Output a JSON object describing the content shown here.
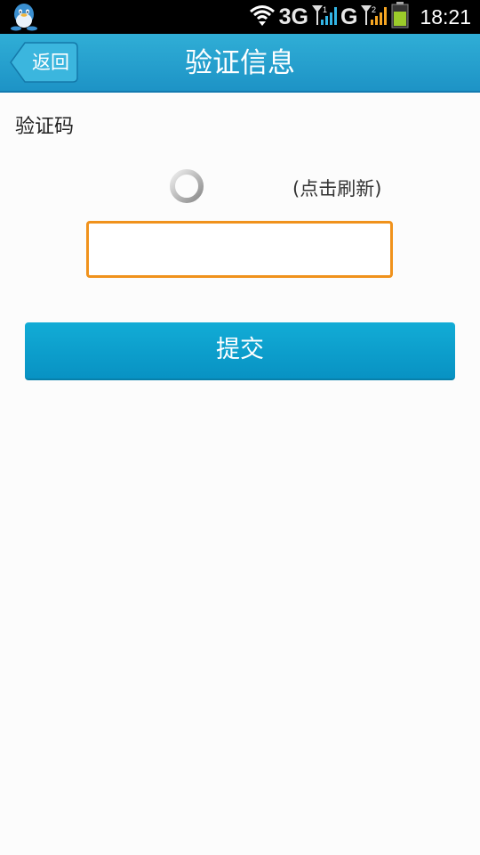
{
  "status_bar": {
    "app_icon": "qq-penguin-icon",
    "wifi_icon": "wifi-icon",
    "network_3g_label": "3G",
    "sim1_signal_icon": "signal-sim1-icon",
    "network_g_label": "G",
    "sim2_signal_icon": "signal-sim2-icon",
    "battery_icon": "battery-icon",
    "battery_color": "#9ccc2a",
    "time": "18:21"
  },
  "header": {
    "back_label": "返回",
    "title": "验证信息",
    "background_color": "#1d93c6"
  },
  "form": {
    "captcha_label": "验证码",
    "captcha_loading_icon": "loading-spinner-icon",
    "refresh_label": "(点击刷新)",
    "input_value": "",
    "input_border_color": "#f0921c",
    "submit_label": "提交",
    "submit_color": "#0fa6d2"
  }
}
